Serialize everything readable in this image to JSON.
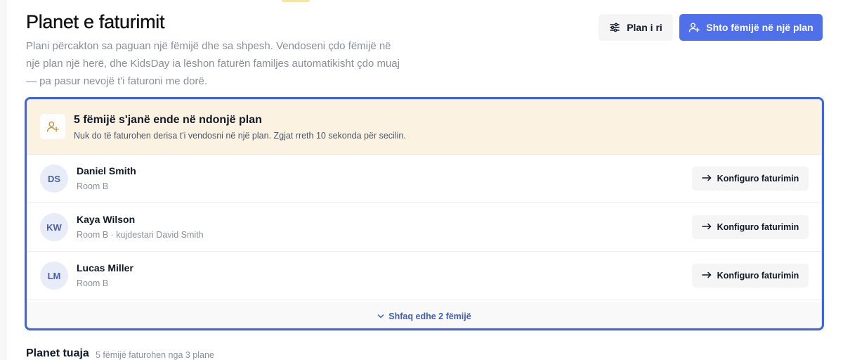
{
  "header": {
    "title": "Planet e faturimit",
    "subtitle": "Plani përcakton sa paguan një fëmijë dhe sa shpesh. Vendoseni çdo fëmijë në një plan një herë, dhe KidsDay ia lëshon faturën familjes automatikisht çdo muaj — pa pasur nevojë t'i faturoni me dorë.",
    "new_plan_label": "Plan i ri",
    "new_plan_icon": "sliders-icon",
    "add_child_label": "Shto fëmijë në një plan",
    "add_child_icon": "user-plus-icon"
  },
  "unassigned": {
    "icon": "user-plus-icon",
    "title": "5 fëmijë s'janë ende në ndonjë plan",
    "description": "Nuk do të faturohen derisa t'i vendosni në një plan. Zgjat rreth 10 sekonda për secilin.",
    "children": [
      {
        "initials": "DS",
        "name": "Daniel Smith",
        "meta": "Room B",
        "action": "Konfiguro faturimin"
      },
      {
        "initials": "KW",
        "name": "Kaya Wilson",
        "meta": "Room B · kujdestari David Smith",
        "action": "Konfiguro faturimin"
      },
      {
        "initials": "LM",
        "name": "Lucas Miller",
        "meta": "Room B",
        "action": "Konfiguro faturimin"
      }
    ],
    "show_more_label": "Shfaq edhe 2 fëmijë"
  },
  "plans_section": {
    "title": "Planet tuaja",
    "meta": "5 fëmijë faturohen nga 3 plane"
  },
  "colors": {
    "primary": "#4f70ea",
    "focus_border": "#3f65e0",
    "alert_bg": "#fbf2e2",
    "link": "#3f5fbf"
  }
}
